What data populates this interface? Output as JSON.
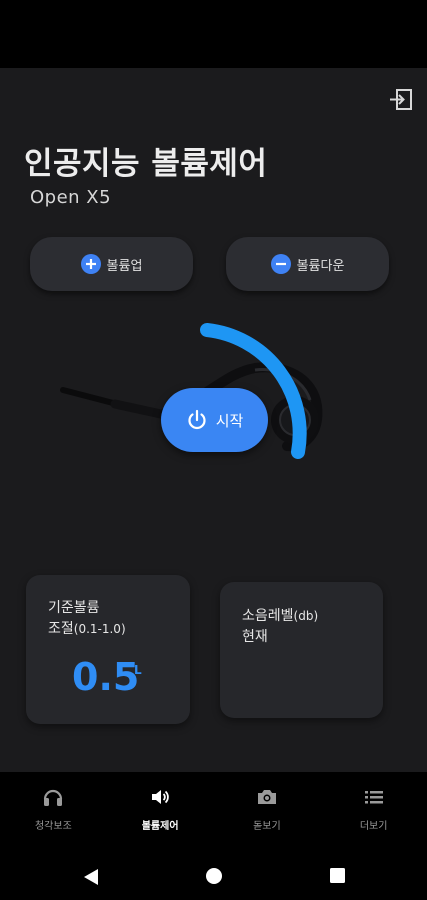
{
  "header": {
    "exit_icon": "exit-icon",
    "title": "인공지능 볼륨제어",
    "subtitle": "Open X5"
  },
  "volume_buttons": {
    "up_label": "볼륨업",
    "up_icon": "plus-circle-icon",
    "down_label": "볼륨다운",
    "down_icon": "minus-circle-icon"
  },
  "device": {
    "image_icon": "earphone-icon",
    "start_label": "시작",
    "start_icon": "power-icon",
    "accent_color": "#2f8df5"
  },
  "cards": {
    "base_volume": {
      "label_line1": "기준볼륨",
      "label_line2": "조절",
      "label_range": "(0.1-1.0)",
      "value": "0.5",
      "unit": "L"
    },
    "noise_level": {
      "label_line1": "소음레벨",
      "label_unit": "(db)",
      "label_line2": "현재"
    }
  },
  "bottom_nav": {
    "items": [
      {
        "label": "청각보조",
        "icon": "headphones-icon",
        "active": false
      },
      {
        "label": "볼륨제어",
        "icon": "speaker-icon",
        "active": true
      },
      {
        "label": "돋보기",
        "icon": "camera-icon",
        "active": false
      },
      {
        "label": "더보기",
        "icon": "list-icon",
        "active": false
      }
    ]
  },
  "system_nav": {
    "back_icon": "back-triangle-icon",
    "home_icon": "home-circle-icon",
    "recents_icon": "recents-square-icon"
  }
}
